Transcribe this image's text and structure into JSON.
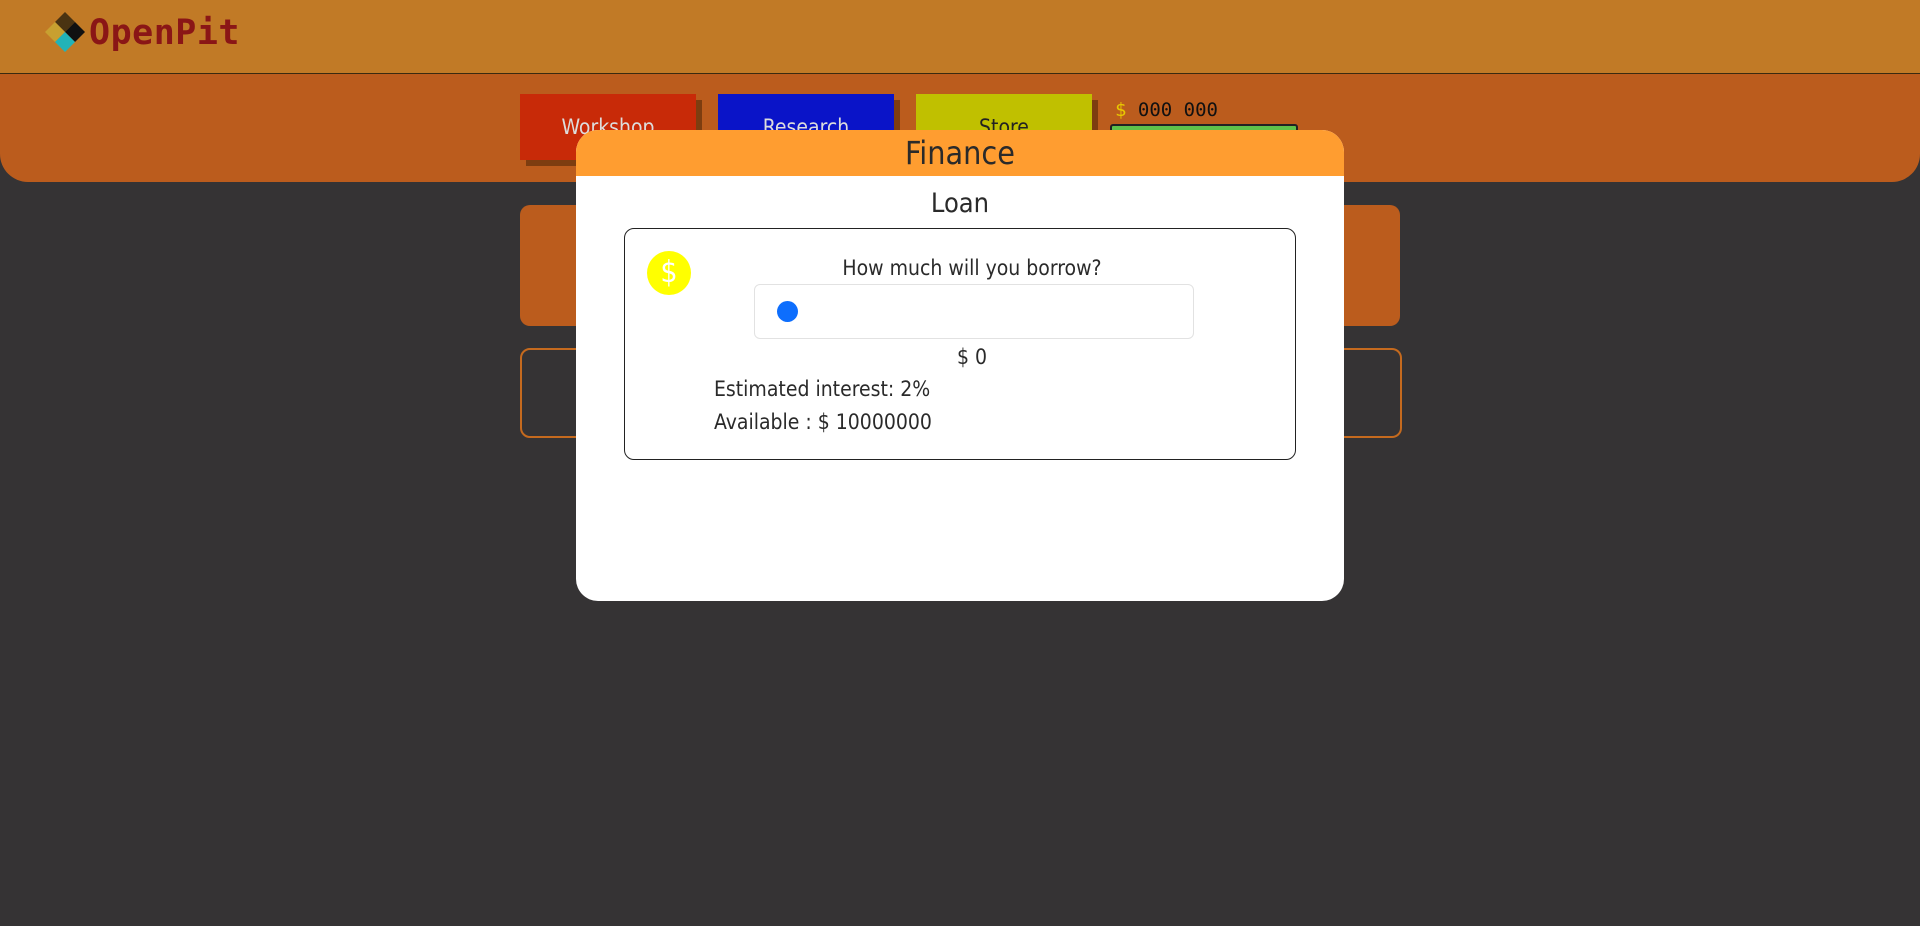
{
  "app": {
    "name": "OpenPit",
    "logo_icon": "diamond-logo-icon"
  },
  "nav": {
    "items": [
      {
        "label": "Workshop",
        "color": "#c82a08"
      },
      {
        "label": "Research",
        "color": "#0a14c8"
      },
      {
        "label": "Store",
        "color": "#c0c000"
      }
    ],
    "money_symbol": "$",
    "money_value": "000 000"
  },
  "modal": {
    "title": "Finance",
    "section_title": "Loan",
    "question": "How much will you borrow?",
    "slider_value_fraction": 0,
    "amount_label": "$ 0",
    "interest_label": "Estimated interest: 2%",
    "available_label": "Available : $ 10000000",
    "icon": "dollar-icon",
    "accent": "#ff9d30"
  }
}
